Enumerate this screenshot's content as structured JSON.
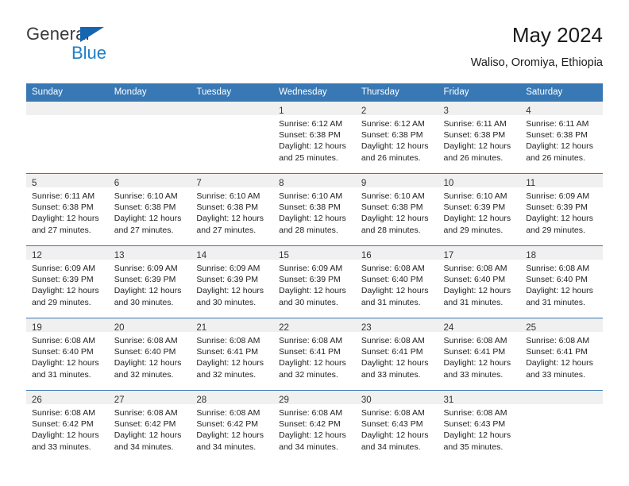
{
  "brand": {
    "name_top": "General",
    "name_bottom": "Blue",
    "triangle_color": "#1565b0",
    "blue_text_color": "#1f7ec7"
  },
  "header": {
    "title": "May 2024",
    "subtitle": "Waliso, Oromiya, Ethiopia"
  },
  "theme": {
    "header_bg": "#3878b4",
    "header_text": "#ffffff",
    "daynum_band_bg": "#f0f0f0",
    "row_separator": "#3878b4",
    "page_bg": "#ffffff"
  },
  "calendar": {
    "weekday_headers": [
      "Sunday",
      "Monday",
      "Tuesday",
      "Wednesday",
      "Thursday",
      "Friday",
      "Saturday"
    ],
    "weeks": [
      [
        {
          "day": "",
          "lines": []
        },
        {
          "day": "",
          "lines": []
        },
        {
          "day": "",
          "lines": []
        },
        {
          "day": "1",
          "lines": [
            "Sunrise: 6:12 AM",
            "Sunset: 6:38 PM",
            "Daylight: 12 hours",
            "and 25 minutes."
          ]
        },
        {
          "day": "2",
          "lines": [
            "Sunrise: 6:12 AM",
            "Sunset: 6:38 PM",
            "Daylight: 12 hours",
            "and 26 minutes."
          ]
        },
        {
          "day": "3",
          "lines": [
            "Sunrise: 6:11 AM",
            "Sunset: 6:38 PM",
            "Daylight: 12 hours",
            "and 26 minutes."
          ]
        },
        {
          "day": "4",
          "lines": [
            "Sunrise: 6:11 AM",
            "Sunset: 6:38 PM",
            "Daylight: 12 hours",
            "and 26 minutes."
          ]
        }
      ],
      [
        {
          "day": "5",
          "lines": [
            "Sunrise: 6:11 AM",
            "Sunset: 6:38 PM",
            "Daylight: 12 hours",
            "and 27 minutes."
          ]
        },
        {
          "day": "6",
          "lines": [
            "Sunrise: 6:10 AM",
            "Sunset: 6:38 PM",
            "Daylight: 12 hours",
            "and 27 minutes."
          ]
        },
        {
          "day": "7",
          "lines": [
            "Sunrise: 6:10 AM",
            "Sunset: 6:38 PM",
            "Daylight: 12 hours",
            "and 27 minutes."
          ]
        },
        {
          "day": "8",
          "lines": [
            "Sunrise: 6:10 AM",
            "Sunset: 6:38 PM",
            "Daylight: 12 hours",
            "and 28 minutes."
          ]
        },
        {
          "day": "9",
          "lines": [
            "Sunrise: 6:10 AM",
            "Sunset: 6:38 PM",
            "Daylight: 12 hours",
            "and 28 minutes."
          ]
        },
        {
          "day": "10",
          "lines": [
            "Sunrise: 6:10 AM",
            "Sunset: 6:39 PM",
            "Daylight: 12 hours",
            "and 29 minutes."
          ]
        },
        {
          "day": "11",
          "lines": [
            "Sunrise: 6:09 AM",
            "Sunset: 6:39 PM",
            "Daylight: 12 hours",
            "and 29 minutes."
          ]
        }
      ],
      [
        {
          "day": "12",
          "lines": [
            "Sunrise: 6:09 AM",
            "Sunset: 6:39 PM",
            "Daylight: 12 hours",
            "and 29 minutes."
          ]
        },
        {
          "day": "13",
          "lines": [
            "Sunrise: 6:09 AM",
            "Sunset: 6:39 PM",
            "Daylight: 12 hours",
            "and 30 minutes."
          ]
        },
        {
          "day": "14",
          "lines": [
            "Sunrise: 6:09 AM",
            "Sunset: 6:39 PM",
            "Daylight: 12 hours",
            "and 30 minutes."
          ]
        },
        {
          "day": "15",
          "lines": [
            "Sunrise: 6:09 AM",
            "Sunset: 6:39 PM",
            "Daylight: 12 hours",
            "and 30 minutes."
          ]
        },
        {
          "day": "16",
          "lines": [
            "Sunrise: 6:08 AM",
            "Sunset: 6:40 PM",
            "Daylight: 12 hours",
            "and 31 minutes."
          ]
        },
        {
          "day": "17",
          "lines": [
            "Sunrise: 6:08 AM",
            "Sunset: 6:40 PM",
            "Daylight: 12 hours",
            "and 31 minutes."
          ]
        },
        {
          "day": "18",
          "lines": [
            "Sunrise: 6:08 AM",
            "Sunset: 6:40 PM",
            "Daylight: 12 hours",
            "and 31 minutes."
          ]
        }
      ],
      [
        {
          "day": "19",
          "lines": [
            "Sunrise: 6:08 AM",
            "Sunset: 6:40 PM",
            "Daylight: 12 hours",
            "and 31 minutes."
          ]
        },
        {
          "day": "20",
          "lines": [
            "Sunrise: 6:08 AM",
            "Sunset: 6:40 PM",
            "Daylight: 12 hours",
            "and 32 minutes."
          ]
        },
        {
          "day": "21",
          "lines": [
            "Sunrise: 6:08 AM",
            "Sunset: 6:41 PM",
            "Daylight: 12 hours",
            "and 32 minutes."
          ]
        },
        {
          "day": "22",
          "lines": [
            "Sunrise: 6:08 AM",
            "Sunset: 6:41 PM",
            "Daylight: 12 hours",
            "and 32 minutes."
          ]
        },
        {
          "day": "23",
          "lines": [
            "Sunrise: 6:08 AM",
            "Sunset: 6:41 PM",
            "Daylight: 12 hours",
            "and 33 minutes."
          ]
        },
        {
          "day": "24",
          "lines": [
            "Sunrise: 6:08 AM",
            "Sunset: 6:41 PM",
            "Daylight: 12 hours",
            "and 33 minutes."
          ]
        },
        {
          "day": "25",
          "lines": [
            "Sunrise: 6:08 AM",
            "Sunset: 6:41 PM",
            "Daylight: 12 hours",
            "and 33 minutes."
          ]
        }
      ],
      [
        {
          "day": "26",
          "lines": [
            "Sunrise: 6:08 AM",
            "Sunset: 6:42 PM",
            "Daylight: 12 hours",
            "and 33 minutes."
          ]
        },
        {
          "day": "27",
          "lines": [
            "Sunrise: 6:08 AM",
            "Sunset: 6:42 PM",
            "Daylight: 12 hours",
            "and 34 minutes."
          ]
        },
        {
          "day": "28",
          "lines": [
            "Sunrise: 6:08 AM",
            "Sunset: 6:42 PM",
            "Daylight: 12 hours",
            "and 34 minutes."
          ]
        },
        {
          "day": "29",
          "lines": [
            "Sunrise: 6:08 AM",
            "Sunset: 6:42 PM",
            "Daylight: 12 hours",
            "and 34 minutes."
          ]
        },
        {
          "day": "30",
          "lines": [
            "Sunrise: 6:08 AM",
            "Sunset: 6:43 PM",
            "Daylight: 12 hours",
            "and 34 minutes."
          ]
        },
        {
          "day": "31",
          "lines": [
            "Sunrise: 6:08 AM",
            "Sunset: 6:43 PM",
            "Daylight: 12 hours",
            "and 35 minutes."
          ]
        },
        {
          "day": "",
          "lines": []
        }
      ]
    ]
  }
}
